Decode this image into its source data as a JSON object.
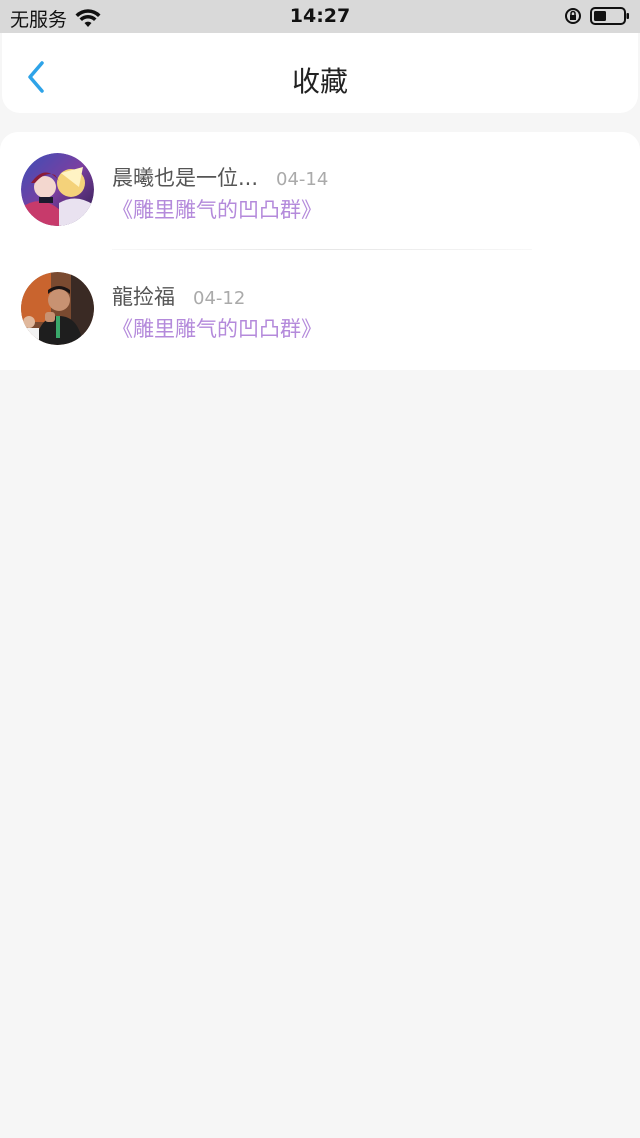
{
  "status_bar": {
    "carrier": "无服务",
    "time": "14:27"
  },
  "nav": {
    "title": "收藏"
  },
  "favorites": [
    {
      "name": "晨曦也是一位...",
      "date": "04-14",
      "group": "《雕里雕气的凹凸群》"
    },
    {
      "name": "龍捡福",
      "date": "04-12",
      "group": "《雕里雕气的凹凸群》"
    }
  ],
  "colors": {
    "accent": "#2ea3e8",
    "group_text": "#b48adb",
    "background": "#f6f6f6"
  }
}
